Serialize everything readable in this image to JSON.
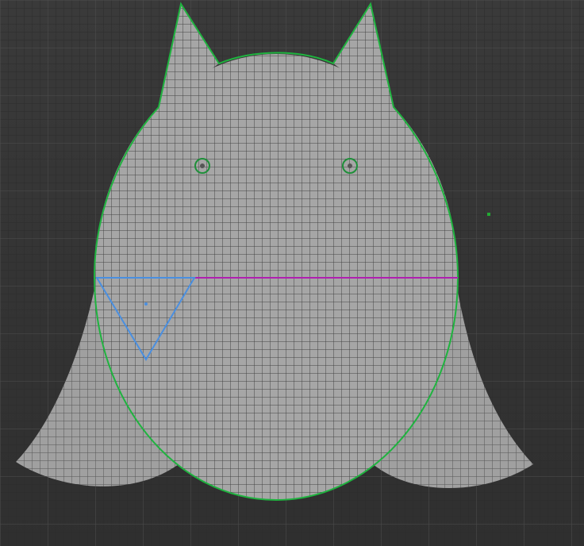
{
  "viewport": {
    "label": "",
    "colors": {
      "background": "#3a3a3a",
      "grid_minor": "#2a2a2a",
      "grid_major": "#555555",
      "shape_fill": "#a6a6a6",
      "wing_fill": "#9d9d9d",
      "selection_outline": "#1fb33f",
      "triangle_outline": "#4a8fe0",
      "guide_line": "#b01fb0",
      "pivot_dot": "#22aa33"
    },
    "icons": {
      "left_eye": "eye-ring-icon",
      "right_eye": "eye-ring-icon",
      "beak": "triangle-icon"
    }
  }
}
